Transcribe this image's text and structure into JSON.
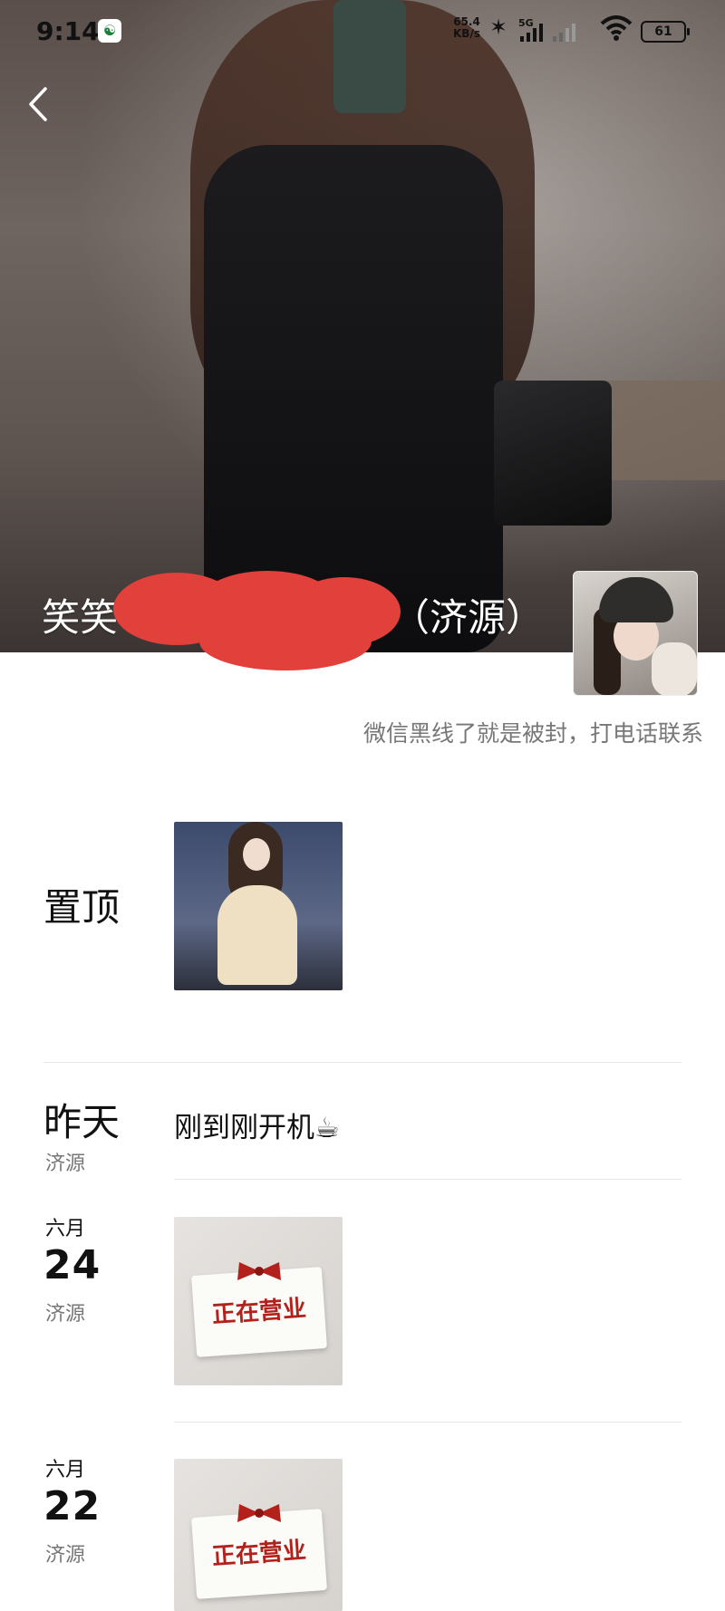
{
  "status_bar": {
    "time": "9:14",
    "net_speed_value": "65.4",
    "net_speed_unit": "KB/s",
    "signal_label": "5G",
    "battery": "61"
  },
  "profile": {
    "name": "笑笑",
    "location_suffix": "（济源）",
    "signature": "微信黑线了就是被封，打电话联系"
  },
  "feed": {
    "pinned_label": "置顶",
    "entries": [
      {
        "date_title": "昨天",
        "location": "济源",
        "text": "刚到刚开机☕"
      },
      {
        "month": "六月",
        "day": "24",
        "location": "济源",
        "image_text": "正在营业"
      },
      {
        "month": "六月",
        "day": "22",
        "location": "济源",
        "image_text": "正在营业"
      }
    ]
  },
  "colors": {
    "redaction": "#e2403b",
    "brand_green": "#1a7f3a"
  },
  "icons": [
    "back-icon",
    "bluetooth-icon",
    "signal-icon",
    "wifi-icon",
    "battery-icon",
    "app-notification-icon"
  ]
}
